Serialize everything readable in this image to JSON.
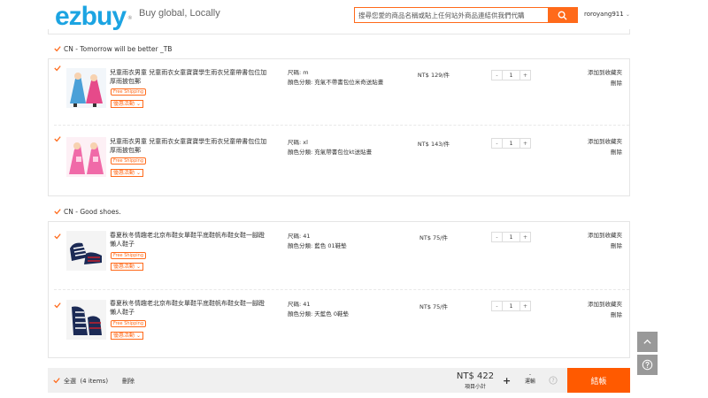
{
  "header": {
    "logo": "ezbuy",
    "logo_mark": "®",
    "slogan": "Buy global, Locally",
    "search_placeholder": "搜尋您愛的商品名稱或貼上任何站外商品連結供我們代購",
    "username": "roroyang911"
  },
  "stores": [
    {
      "title": "CN - Tomorrow will be better _TB",
      "items": [
        {
          "title": "兒童雨衣男童 兒童雨衣女童寶寶學生雨衣兒童帶書包位加厚雨披包郵",
          "free_shipping": "Free Shipping",
          "promo": "優惠活動",
          "size": "尺碼: m",
          "color": "顏色分類: 充氣不帶書包位米奇送貼畫",
          "price": "NT$ 129/件",
          "qty": "1",
          "add_fav": "添加到收藏夾",
          "delete": "刪除",
          "img_colors": [
            "#4aa0d8",
            "#e64a8a"
          ]
        },
        {
          "title": "兒童雨衣男童 兒童雨衣女童寶寶學生雨衣兒童帶書包位加厚雨披包郵",
          "free_shipping": "Free Shipping",
          "promo": "優惠活動",
          "size": "尺碼: xl",
          "color": "顏色分類: 充氣帶書包位kt送貼畫",
          "price": "NT$ 143/件",
          "qty": "1",
          "add_fav": "添加到收藏夾",
          "delete": "刪除",
          "img_colors": [
            "#f06aa8",
            "#ffd1e4"
          ]
        }
      ]
    },
    {
      "title": "CN - Good shoes.",
      "items": [
        {
          "title": "春夏秋冬情趣老北京布鞋女單鞋平底鞋帆布鞋女鞋一腳蹬懶人鞋子",
          "free_shipping": "Free Shipping",
          "promo": "優惠活動",
          "size": "尺碼: 41",
          "color": "顏色分類: 藍色 01鞋墊",
          "price": "NT$ 75/件",
          "qty": "1",
          "add_fav": "添加到收藏夾",
          "delete": "刪除",
          "img_colors": [
            "#1b2a55",
            "#c4202c"
          ]
        },
        {
          "title": "春夏秋冬情趣老北京布鞋女單鞋平底鞋帆布鞋女鞋一腳蹬懶人鞋子",
          "free_shipping": "Free Shipping",
          "promo": "優惠活動",
          "size": "尺碼: 41",
          "color": "顏色分類: 天藍色 0鞋墊",
          "price": "NT$ 75/件",
          "qty": "1",
          "add_fav": "添加到收藏夾",
          "delete": "刪除",
          "img_colors": [
            "#1b2a55",
            "#c4202c"
          ]
        }
      ]
    }
  ],
  "footer": {
    "select_all": "全選",
    "item_count": "(4 items)",
    "delete": "刪除",
    "total": "NT$ 422",
    "total_label": "項目小計",
    "plus": "+",
    "shipping_value": "-",
    "shipping_label": "運輸",
    "checkout": "結帳"
  },
  "colors": {
    "brand": "#1ca4e2",
    "accent": "#ff6a1a",
    "checkout": "#ff5a00"
  }
}
